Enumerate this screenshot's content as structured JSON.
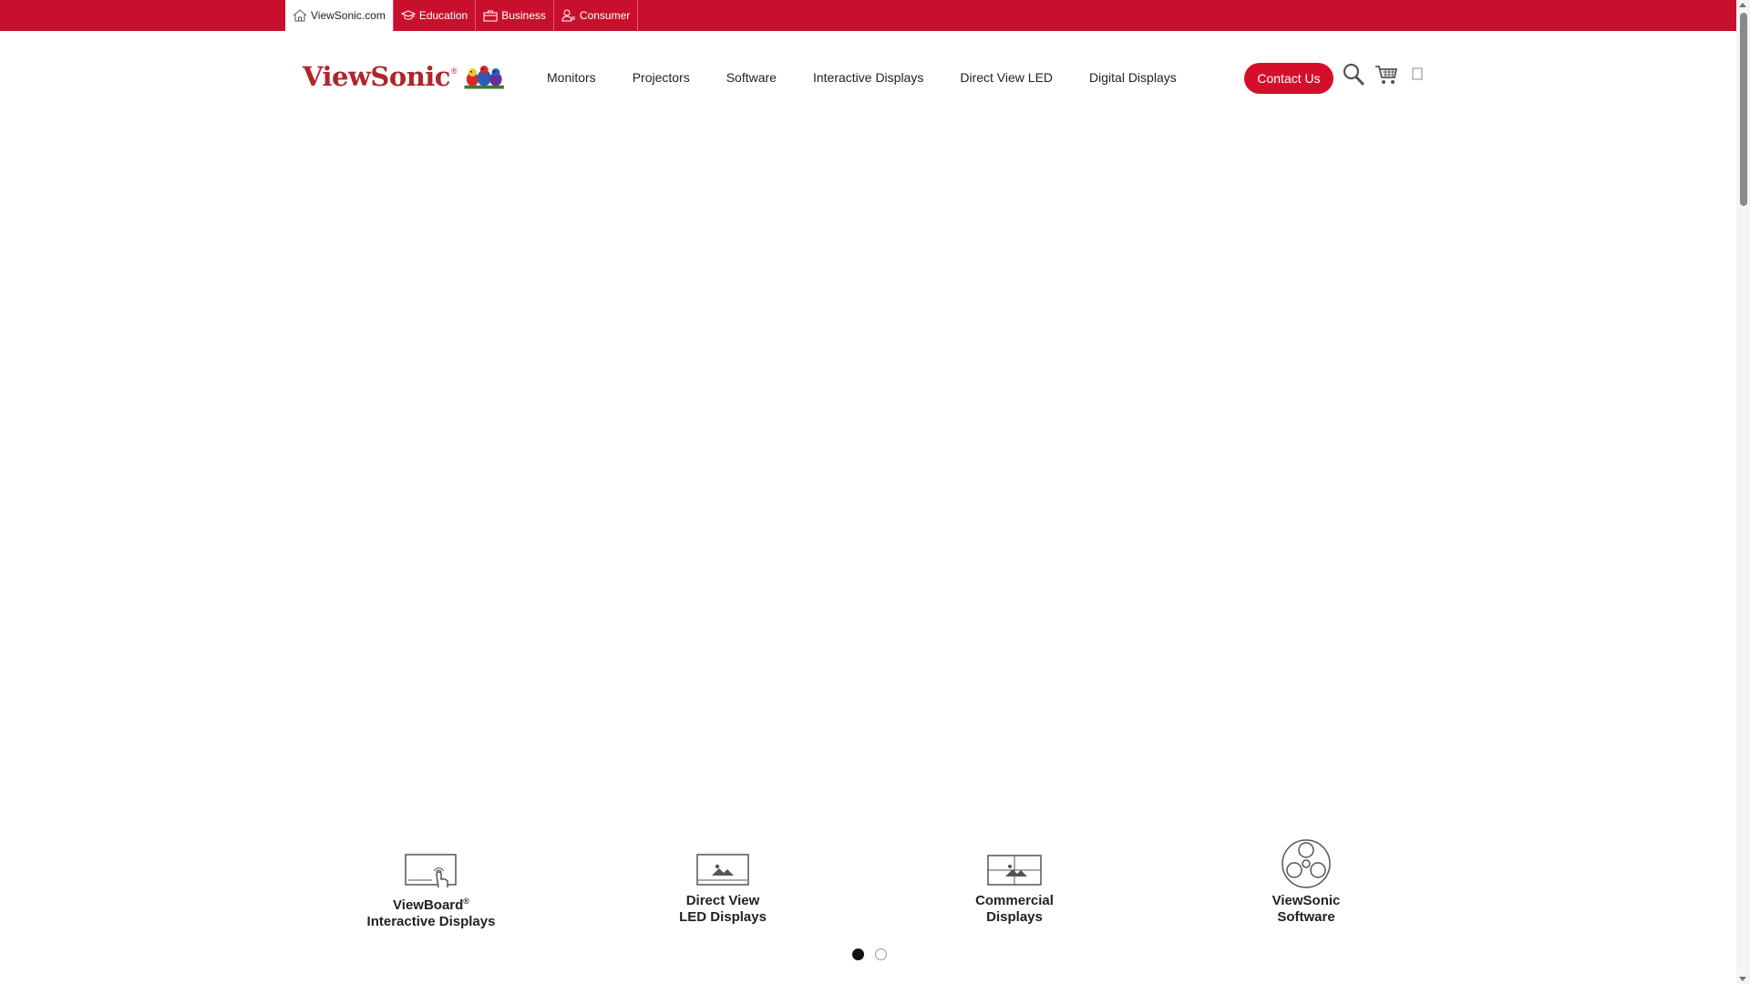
{
  "top_tabs": [
    {
      "label": "ViewSonic.com",
      "icon": "home-icon",
      "active": true
    },
    {
      "label": "Education",
      "icon": "graduation-cap-icon",
      "active": false
    },
    {
      "label": "Business",
      "icon": "briefcase-icon",
      "active": false
    },
    {
      "label": "Consumer",
      "icon": "user-icon",
      "active": false
    }
  ],
  "header": {
    "logo_text": "ViewSonic",
    "logo_reg": "®",
    "nav": [
      "Monitors",
      "Projectors",
      "Software",
      "Interactive Displays",
      "Direct View LED",
      "Digital Displays"
    ],
    "contact_label": "Contact Us"
  },
  "categories": [
    {
      "line1": "ViewBoard",
      "sup": "®",
      "line2": "Interactive Displays",
      "icon": "touch-display-icon"
    },
    {
      "line1": "Direct View",
      "sup": "",
      "line2": "LED Displays",
      "icon": "led-display-icon"
    },
    {
      "line1": "Commercial",
      "sup": "",
      "line2": "Displays",
      "icon": "commercial-display-icon"
    },
    {
      "line1": "ViewSonic",
      "sup": "",
      "line2": "Software",
      "icon": "software-reel-icon"
    }
  ],
  "carousel": {
    "active_index": 0,
    "count": 2
  },
  "colors": {
    "brand_red": "#c8102e",
    "button_red": "#d50f2b",
    "logo_red": "#b0252d"
  }
}
